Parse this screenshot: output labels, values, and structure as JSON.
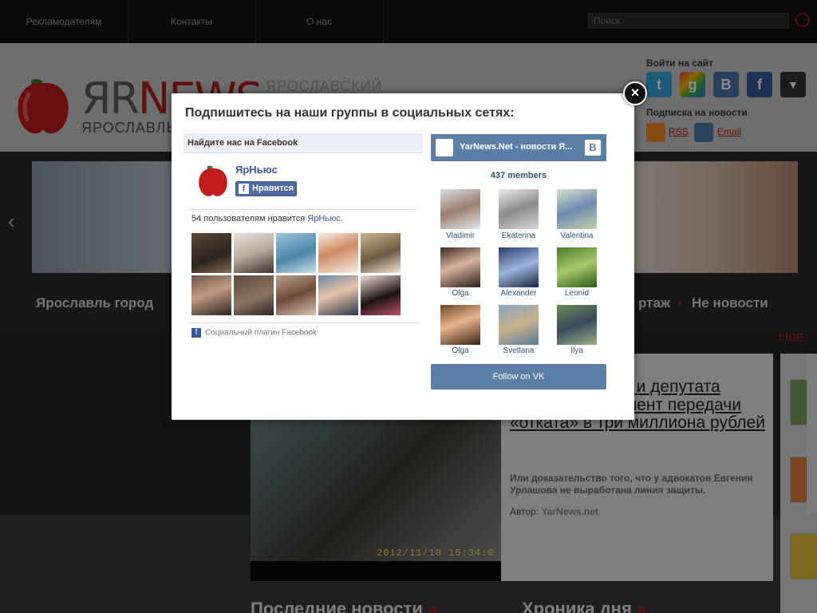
{
  "topnav": {
    "links": [
      "Рекламодателям",
      "Контакты",
      "О нас"
    ],
    "search_placeholder": "Поиск"
  },
  "header": {
    "logo_yr": "ЯR",
    "logo_news": "NEWS",
    "logo_sub": "ЯРОСЛАВЛЬ",
    "tagline": "ЯРОСЛАВСКИЙ",
    "login_label": "Войти на сайт",
    "subscribe_label": "Подписка на новости",
    "rss_label": "RSS",
    "email_label": "Email",
    "social_icons": [
      "twitter-icon",
      "google-icon",
      "vkontakte-icon",
      "facebook-icon",
      "dropdown-icon"
    ]
  },
  "catnav": {
    "items": [
      "Ярославль город",
      "ртаж",
      "Не новости"
    ]
  },
  "article": {
    "title": "мэра Урлашова и депутата Авдаляна в момент передачи «отката» в три миллиона рублей",
    "description": "Или доказательство того, что у адвокатов Евгения Урлашова не выработана линия защиты.",
    "author_label": "Автор:",
    "author_name": "YarNews.net",
    "video_timestamp": "2012/11/18 15:34:0"
  },
  "sections": {
    "news_side": "Нов",
    "latest": "Последние новости",
    "chronicle": "Хроника дня"
  },
  "modal": {
    "title": "Подпишитесь на наши группы в социальных сетях:",
    "close_glyph": "×",
    "facebook": {
      "header": "Найдите нас на Facebook",
      "page_name": "ЯрНьюс",
      "like_button": "Нравится",
      "count_text": "54 пользователям нравится ",
      "count_link": "ЯрНьюс",
      "count_end": ".",
      "footer": "Социальный плагин Facebook"
    },
    "vk": {
      "title": "YarNews.Net - новости Я...",
      "logo_letter": "В",
      "members": "437 members",
      "people": [
        "Vladimir",
        "Ekaterina",
        "Valentina",
        "Olga",
        "Alexander",
        "Leonid",
        "Olga",
        "Svetlana",
        "Ilya"
      ],
      "follow_button": "Follow on VK"
    }
  },
  "colors": {
    "brand_red": "#b01e1e",
    "facebook_blue": "#4e69a2",
    "vk_blue": "#5b7fa6"
  }
}
